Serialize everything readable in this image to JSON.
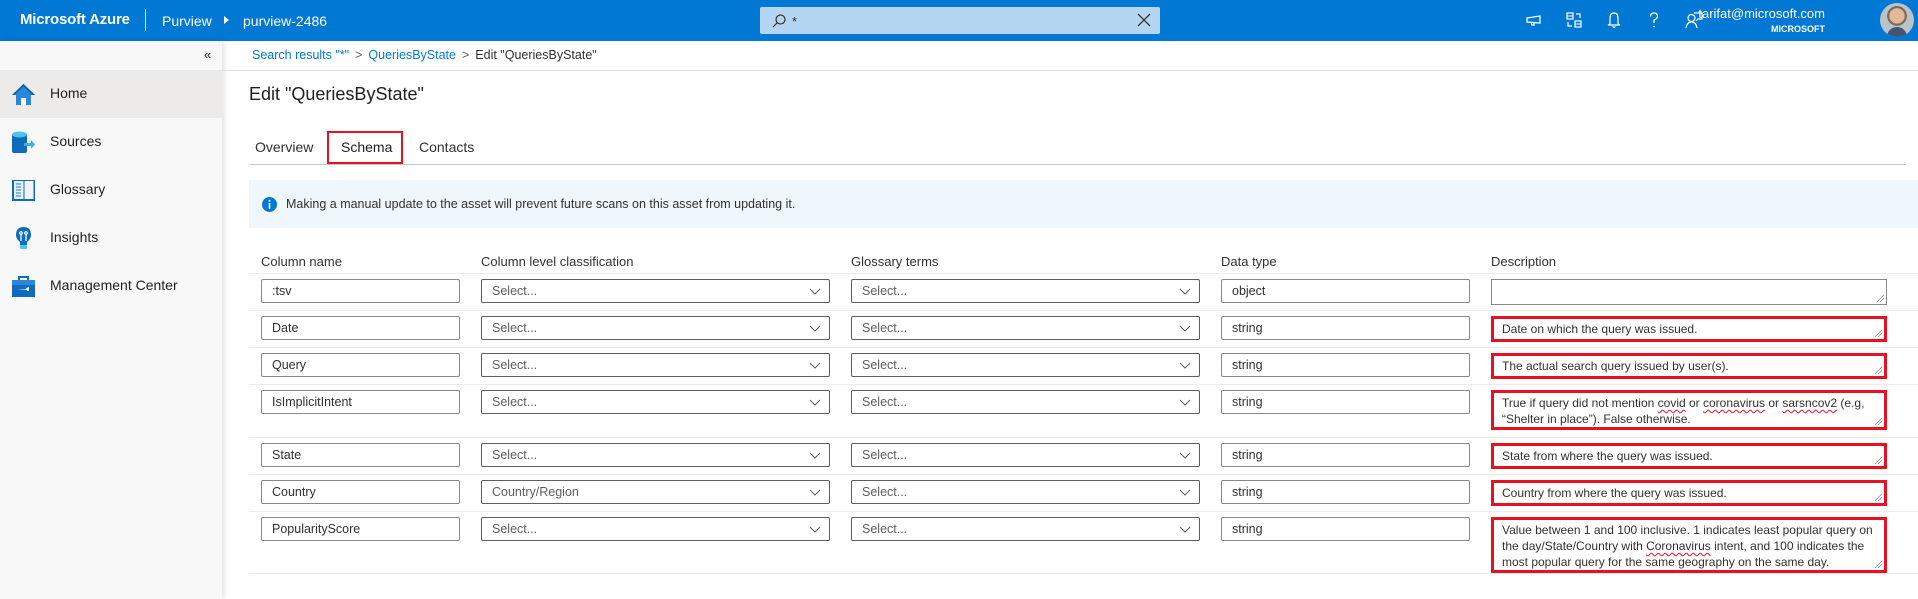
{
  "topbar": {
    "brand": "Microsoft Azure",
    "service": "Purview",
    "resource": "purview-2486",
    "search_value": "*",
    "icons": [
      "feedback-icon",
      "directory-switch-icon",
      "notifications-icon",
      "help-icon",
      "support-icon"
    ],
    "user_email": "tarifat@microsoft.com",
    "user_org": "MICROSOFT"
  },
  "sidebar": {
    "collapse_label": "«",
    "items": [
      {
        "label": "Home",
        "icon": "home-icon",
        "active": true
      },
      {
        "label": "Sources",
        "icon": "sources-icon",
        "active": false
      },
      {
        "label": "Glossary",
        "icon": "glossary-icon",
        "active": false
      },
      {
        "label": "Insights",
        "icon": "insights-icon",
        "active": false
      },
      {
        "label": "Management Center",
        "icon": "management-icon",
        "active": false
      }
    ]
  },
  "breadcrumb": {
    "items": [
      "Search results \"*\"",
      "QueriesByState"
    ],
    "current": "Edit \"QueriesByState\"",
    "separator": ">"
  },
  "page": {
    "title": "Edit \"QueriesByState\"",
    "tabs": [
      {
        "label": "Overview",
        "selected": false
      },
      {
        "label": "Schema",
        "selected": true
      },
      {
        "label": "Contacts",
        "selected": false
      }
    ],
    "info_message": "Making a manual update to the asset will prevent future scans on this asset from updating it."
  },
  "schema": {
    "headers": [
      "Column name",
      "Column level classification",
      "Glossary terms",
      "Data type",
      "Description"
    ],
    "rows": [
      {
        "name": ":tsv",
        "classification": "Select...",
        "glossary": "Select...",
        "type": "object",
        "description": ""
      },
      {
        "name": "Date",
        "classification": "Select...",
        "glossary": "Select...",
        "type": "string",
        "description": "Date on which the query was issued."
      },
      {
        "name": "Query",
        "classification": "Select...",
        "glossary": "Select...",
        "type": "string",
        "description": "The actual search query issued by user(s)."
      },
      {
        "name": "IsImplicitIntent",
        "classification": "Select...",
        "glossary": "Select...",
        "type": "string",
        "description_parts": [
          "True if query did not mention ",
          "covid",
          " or ",
          "coronavirus",
          " or ",
          "sarsncov2",
          " (e.g, “Shelter in place”). False otherwise."
        ]
      },
      {
        "name": "State",
        "classification": "Select...",
        "glossary": "Select...",
        "type": "string",
        "description": "State from where the query was issued."
      },
      {
        "name": "Country",
        "classification": "Country/Region",
        "glossary": "Select...",
        "type": "string",
        "description": "Country from where the query was issued."
      },
      {
        "name": "PopularityScore",
        "classification": "Select...",
        "glossary": "Select...",
        "type": "string",
        "description_parts": [
          "Value between 1 and 100 inclusive. 1 indicates least popular query on the day/State/Country with ",
          "Coronavirus",
          " intent, and 100 indicates the most popular query for the same geography on the same day."
        ]
      }
    ]
  }
}
